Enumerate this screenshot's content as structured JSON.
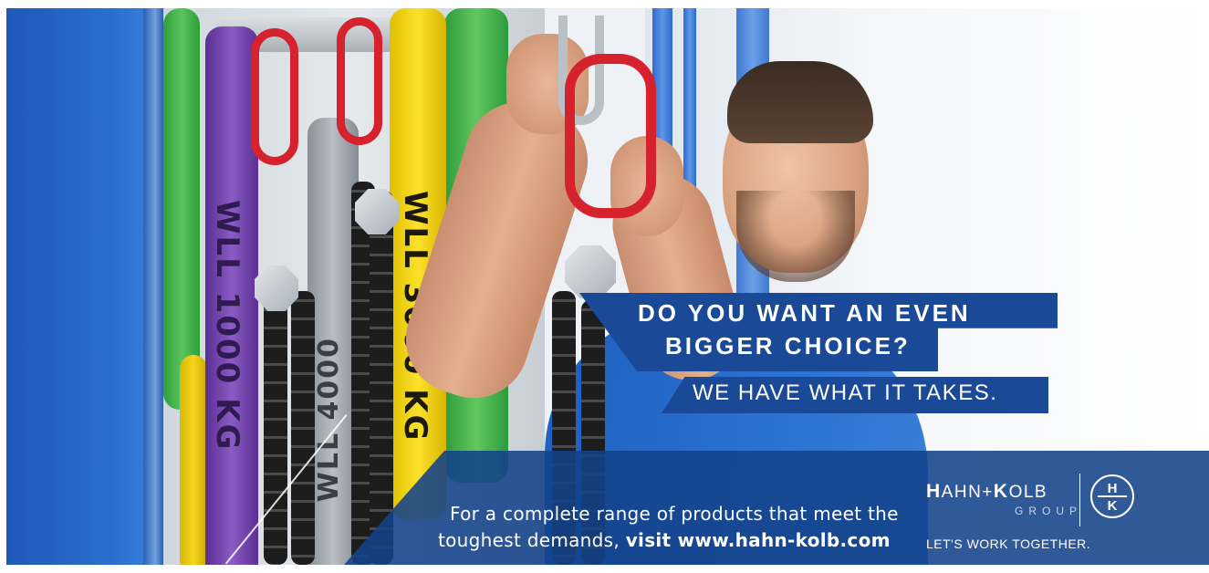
{
  "ad": {
    "headline_line1": "DO YOU WANT AN EVEN",
    "headline_line2": "BIGGER CHOICE?",
    "subheadline": "WE HAVE WHAT IT TAKES.",
    "body_line1": "For a complete range of products that meet the",
    "body_line2_prefix": "toughest demands, ",
    "body_link": "visit www.hahn-kolb.com"
  },
  "brand": {
    "name_prefix_big": "H",
    "name_mid": "AHN+",
    "name_k_big": "K",
    "name_suffix": "OLB",
    "group": "GROUP",
    "tagline": "LET'S WORK TOGETHER.",
    "logo_letter_top": "H",
    "logo_letter_bottom": "K"
  },
  "slings": {
    "label_purple": "WLL 1000 KG",
    "label_grey": "WLL 4000",
    "label_yellow": "WLL 3000 KG"
  },
  "colors": {
    "brand_blue": "#1a4a97",
    "panel_blue": "#13428a",
    "text_white": "#ffffff",
    "chain_red": "#d6222c"
  }
}
